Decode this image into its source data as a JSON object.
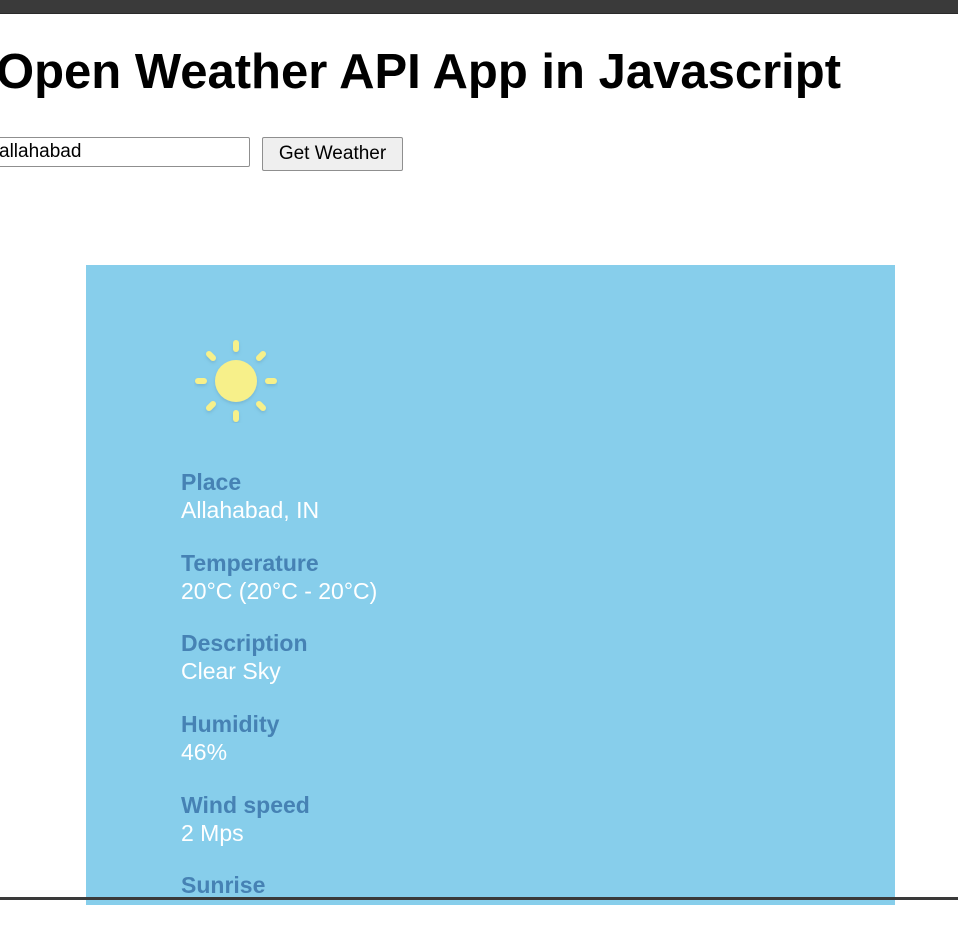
{
  "header": {
    "title": "Open Weather API App in Javascript"
  },
  "search": {
    "value": "allahabad",
    "button_label": "Get Weather"
  },
  "weather": {
    "icon": "sun-icon",
    "icon_color": "#f7f08a",
    "card_color": "#87ceeb",
    "label_color": "#4682b4",
    "fields": [
      {
        "label": "Place",
        "value": "Allahabad, IN"
      },
      {
        "label": "Temperature",
        "value": "20°C (20°C - 20°C)"
      },
      {
        "label": "Description",
        "value": "Clear Sky"
      },
      {
        "label": "Humidity",
        "value": "46%"
      },
      {
        "label": "Wind speed",
        "value": "2 Mps"
      },
      {
        "label": "Sunrise",
        "value": ""
      }
    ]
  }
}
